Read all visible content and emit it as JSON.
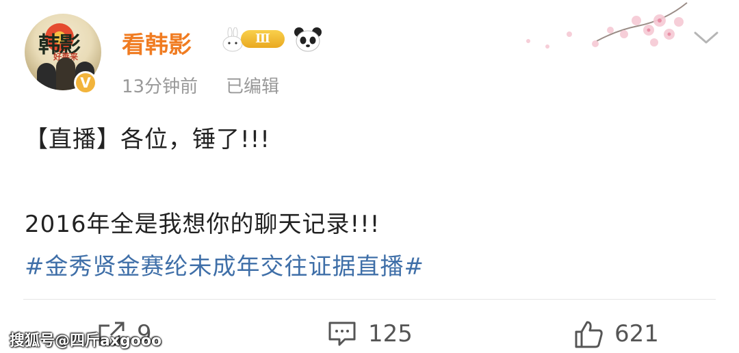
{
  "author": {
    "avatar_text": "韩影",
    "avatar_sub": "好莱来",
    "name": "看韩影",
    "level": "Ⅲ",
    "verified_mark": "V",
    "icons": [
      "rabbit-icon",
      "level-badge",
      "panda-icon",
      "verified-badge-icon"
    ]
  },
  "meta": {
    "time": "13分钟前",
    "edited": "已编辑"
  },
  "post": {
    "line1": "【直播】各位，锤了!!!",
    "line2": "2016年全是我想你的聊天记录!!!",
    "hashtag": "#金秀贤金赛纶未成年交往证据直播#"
  },
  "actions": {
    "repost_count": "9",
    "comment_count": "125",
    "like_count": "621"
  },
  "watermark": "搜狐号@四斤axgooo",
  "colors": {
    "username": "#f07c22",
    "hashtag": "#3f6fa8",
    "meta": "#999999",
    "badge": "#f2b43c"
  }
}
